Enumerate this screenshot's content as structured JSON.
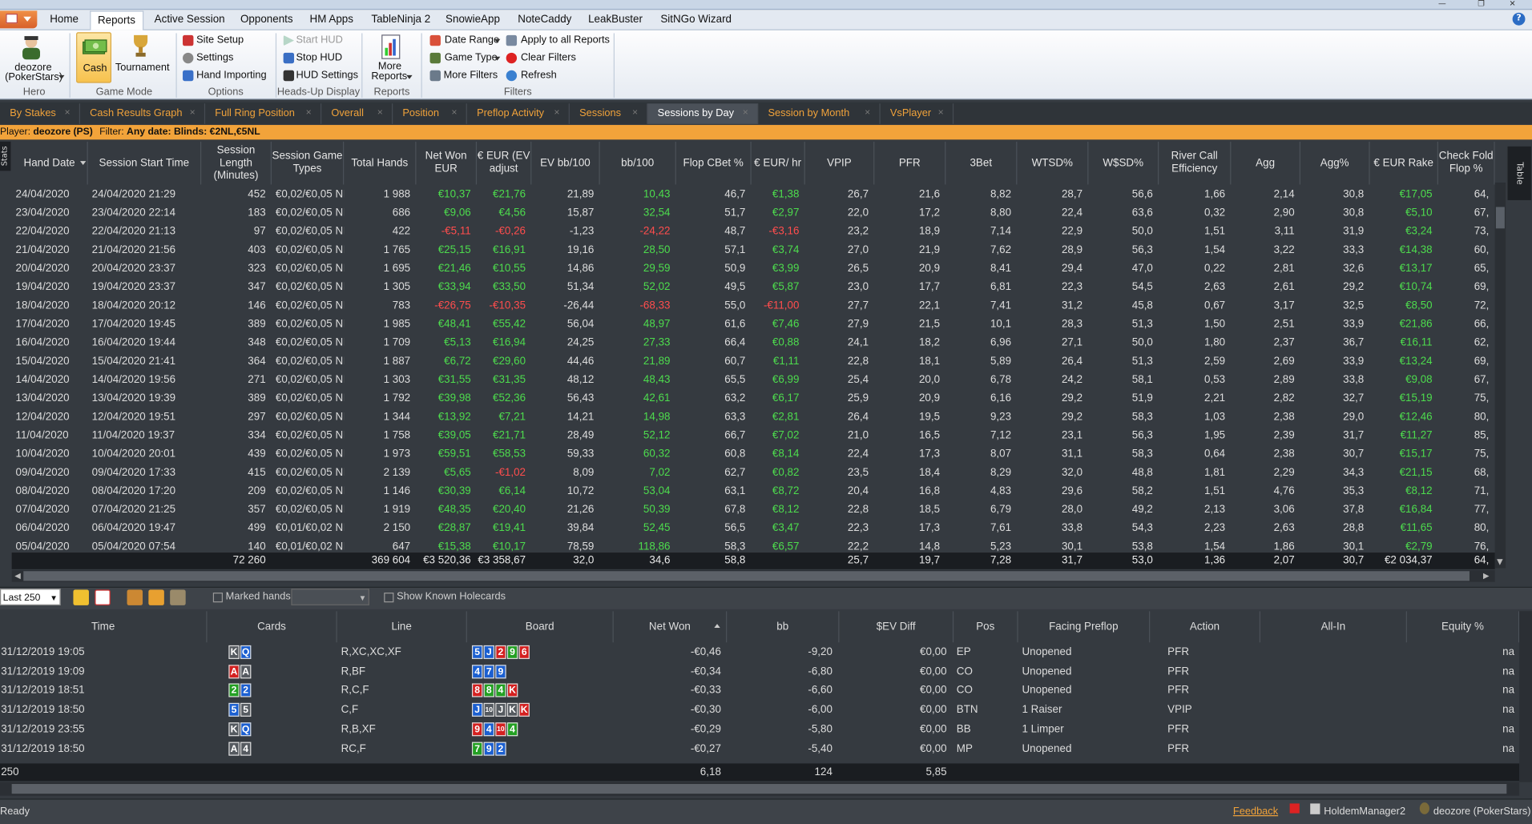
{
  "menu": {
    "tabs": [
      "Home",
      "Reports",
      "Active Session",
      "Opponents",
      "HM Apps",
      "TableNinja 2",
      "SnowieApp",
      "NoteCaddy",
      "LeakBuster",
      "SitNGo Wizard"
    ],
    "active": "Reports"
  },
  "ribbon": {
    "hero": {
      "name": "deozore",
      "site": "(PokerStars)",
      "group": "Hero"
    },
    "game_mode": {
      "cash": "Cash",
      "tournament": "Tournament",
      "group": "Game Mode"
    },
    "options": {
      "site_setup": "Site Setup",
      "settings": "Settings",
      "hand_importing": "Hand Importing",
      "group": "Options"
    },
    "hud": {
      "start": "Start HUD",
      "stop": "Stop HUD",
      "settings": "HUD Settings",
      "group": "Heads-Up Display"
    },
    "reports": {
      "more1": "More",
      "more2": "Reports",
      "group": "Reports"
    },
    "filters": {
      "date_range": "Date Range",
      "game_type": "Game Type",
      "more_filters": "More Filters",
      "apply_all": "Apply to all Reports",
      "clear": "Clear Filters",
      "refresh": "Refresh",
      "group": "Filters"
    }
  },
  "report_tabs": [
    "By Stakes",
    "Cash Results Graph",
    "Full Ring Position",
    "Overall",
    "Position",
    "Preflop Activity",
    "Sessions",
    "Sessions by Day",
    "Session by Month",
    "VsPlayer"
  ],
  "active_report_tab": "Sessions by Day",
  "filter_bar": {
    "player_label": "Player:",
    "player": "deozore (PS)",
    "filter_label": "Filter:",
    "filter": "Any date: Blinds: €2NL,€5NL"
  },
  "side_tab": "Stats",
  "table_side_tab": "Table",
  "grid": {
    "columns": [
      "Hand Date",
      "Session Start Time",
      "Session Length (Minutes)",
      "Session Game Types",
      "Total Hands",
      "Net Won EUR",
      "€ EUR (EV adjust",
      "EV bb/100",
      "bb/100",
      "Flop CBet %",
      "€ EUR/ hr",
      "VPIP",
      "PFR",
      "3Bet",
      "WTSD%",
      "W$SD%",
      "River Call Efficiency",
      "Agg",
      "Agg%",
      "€ EUR Rake",
      "Check Fold Flop %"
    ],
    "rows": [
      [
        "24/04/2020",
        "24/04/2020 21:29",
        "452",
        "€0,02/€0,05 NI",
        "1 988",
        "€10,37",
        "€21,76",
        "21,89",
        "10,43",
        "46,7",
        "€1,38",
        "26,7",
        "21,6",
        "8,82",
        "28,7",
        "56,6",
        "1,66",
        "2,14",
        "30,8",
        "€17,05",
        "64,"
      ],
      [
        "23/04/2020",
        "23/04/2020 22:14",
        "183",
        "€0,02/€0,05 NI",
        "686",
        "€9,06",
        "€4,56",
        "15,87",
        "32,54",
        "51,7",
        "€2,97",
        "22,0",
        "17,2",
        "8,80",
        "22,4",
        "63,6",
        "0,32",
        "2,90",
        "30,8",
        "€5,10",
        "67,"
      ],
      [
        "22/04/2020",
        "22/04/2020 21:13",
        "97",
        "€0,02/€0,05 NI",
        "422",
        "-€5,11",
        "-€0,26",
        "-1,23",
        "-24,22",
        "48,7",
        "-€3,16",
        "23,2",
        "18,9",
        "7,14",
        "22,9",
        "50,0",
        "1,51",
        "3,11",
        "31,9",
        "€3,24",
        "73,"
      ],
      [
        "21/04/2020",
        "21/04/2020 21:56",
        "403",
        "€0,02/€0,05 NI",
        "1 765",
        "€25,15",
        "€16,91",
        "19,16",
        "28,50",
        "57,1",
        "€3,74",
        "27,0",
        "21,9",
        "7,62",
        "28,9",
        "56,3",
        "1,54",
        "3,22",
        "33,3",
        "€14,38",
        "60,"
      ],
      [
        "20/04/2020",
        "20/04/2020 23:37",
        "323",
        "€0,02/€0,05 NI",
        "1 695",
        "€21,46",
        "€10,55",
        "14,86",
        "29,59",
        "50,9",
        "€3,99",
        "26,5",
        "20,9",
        "8,41",
        "29,4",
        "47,0",
        "0,22",
        "2,81",
        "32,6",
        "€13,17",
        "65,"
      ],
      [
        "19/04/2020",
        "19/04/2020 23:37",
        "347",
        "€0,02/€0,05 NI",
        "1 305",
        "€33,94",
        "€33,50",
        "51,34",
        "52,02",
        "49,5",
        "€5,87",
        "23,0",
        "17,7",
        "6,81",
        "22,3",
        "54,5",
        "2,63",
        "2,61",
        "29,2",
        "€10,74",
        "69,"
      ],
      [
        "18/04/2020",
        "18/04/2020 20:12",
        "146",
        "€0,02/€0,05 NI",
        "783",
        "-€26,75",
        "-€10,35",
        "-26,44",
        "-68,33",
        "55,0",
        "-€11,00",
        "27,7",
        "22,1",
        "7,41",
        "31,2",
        "45,8",
        "0,67",
        "3,17",
        "32,5",
        "€8,50",
        "72,"
      ],
      [
        "17/04/2020",
        "17/04/2020 19:45",
        "389",
        "€0,02/€0,05 NI",
        "1 985",
        "€48,41",
        "€55,42",
        "56,04",
        "48,97",
        "61,6",
        "€7,46",
        "27,9",
        "21,5",
        "10,1",
        "28,3",
        "51,3",
        "1,50",
        "2,51",
        "33,9",
        "€21,86",
        "66,"
      ],
      [
        "16/04/2020",
        "16/04/2020 19:44",
        "348",
        "€0,02/€0,05 NI",
        "1 709",
        "€5,13",
        "€16,94",
        "24,25",
        "27,33",
        "66,4",
        "€0,88",
        "24,1",
        "18,2",
        "6,96",
        "27,1",
        "50,0",
        "1,80",
        "2,37",
        "36,7",
        "€16,11",
        "62,"
      ],
      [
        "15/04/2020",
        "15/04/2020 21:41",
        "364",
        "€0,02/€0,05 NI",
        "1 887",
        "€6,72",
        "€29,60",
        "44,46",
        "21,89",
        "60,7",
        "€1,11",
        "22,8",
        "18,1",
        "5,89",
        "26,4",
        "51,3",
        "2,59",
        "2,69",
        "33,9",
        "€13,24",
        "69,"
      ],
      [
        "14/04/2020",
        "14/04/2020 19:56",
        "271",
        "€0,02/€0,05 NI",
        "1 303",
        "€31,55",
        "€31,35",
        "48,12",
        "48,43",
        "65,5",
        "€6,99",
        "25,4",
        "20,0",
        "6,78",
        "24,2",
        "58,1",
        "0,53",
        "2,89",
        "33,8",
        "€9,08",
        "67,"
      ],
      [
        "13/04/2020",
        "13/04/2020 19:39",
        "389",
        "€0,02/€0,05 NI",
        "1 792",
        "€39,98",
        "€52,36",
        "56,43",
        "42,61",
        "63,2",
        "€6,17",
        "25,9",
        "20,9",
        "6,16",
        "29,2",
        "51,9",
        "2,21",
        "2,82",
        "32,7",
        "€15,19",
        "75,"
      ],
      [
        "12/04/2020",
        "12/04/2020 19:51",
        "297",
        "€0,02/€0,05 NI",
        "1 344",
        "€13,92",
        "€7,21",
        "14,21",
        "14,98",
        "63,3",
        "€2,81",
        "26,4",
        "19,5",
        "9,23",
        "29,2",
        "58,3",
        "1,03",
        "2,38",
        "29,0",
        "€12,46",
        "80,"
      ],
      [
        "11/04/2020",
        "11/04/2020 19:37",
        "334",
        "€0,02/€0,05 NI",
        "1 758",
        "€39,05",
        "€21,71",
        "28,49",
        "52,12",
        "66,7",
        "€7,02",
        "21,0",
        "16,5",
        "7,12",
        "23,1",
        "56,3",
        "1,95",
        "2,39",
        "31,7",
        "€11,27",
        "85,"
      ],
      [
        "10/04/2020",
        "10/04/2020 20:01",
        "439",
        "€0,02/€0,05 NI",
        "1 973",
        "€59,51",
        "€58,53",
        "59,33",
        "60,32",
        "60,8",
        "€8,14",
        "22,4",
        "17,3",
        "8,07",
        "31,1",
        "58,3",
        "0,64",
        "2,38",
        "30,7",
        "€15,17",
        "75,"
      ],
      [
        "09/04/2020",
        "09/04/2020 17:33",
        "415",
        "€0,02/€0,05 NI",
        "2 139",
        "€5,65",
        "-€1,02",
        "8,09",
        "7,02",
        "62,7",
        "€0,82",
        "23,5",
        "18,4",
        "8,29",
        "32,0",
        "48,8",
        "1,81",
        "2,29",
        "34,3",
        "€21,15",
        "68,"
      ],
      [
        "08/04/2020",
        "08/04/2020 17:20",
        "209",
        "€0,02/€0,05 NI",
        "1 146",
        "€30,39",
        "€6,14",
        "10,72",
        "53,04",
        "63,1",
        "€8,72",
        "20,4",
        "16,8",
        "4,83",
        "29,6",
        "58,2",
        "1,51",
        "4,76",
        "35,3",
        "€8,12",
        "71,"
      ],
      [
        "07/04/2020",
        "07/04/2020 21:25",
        "357",
        "€0,02/€0,05 NI",
        "1 919",
        "€48,35",
        "€20,40",
        "21,26",
        "50,39",
        "67,8",
        "€8,12",
        "22,8",
        "18,5",
        "6,79",
        "28,0",
        "49,2",
        "2,13",
        "3,06",
        "37,8",
        "€16,84",
        "77,"
      ],
      [
        "06/04/2020",
        "06/04/2020 19:47",
        "499",
        "€0,01/€0,02 NI",
        "2 150",
        "€28,87",
        "€19,41",
        "39,84",
        "52,45",
        "56,5",
        "€3,47",
        "22,3",
        "17,3",
        "7,61",
        "33,8",
        "54,3",
        "2,23",
        "2,63",
        "28,8",
        "€11,65",
        "80,"
      ],
      [
        "05/04/2020",
        "05/04/2020 07:54",
        "140",
        "€0,01/€0,02 NI",
        "647",
        "€15,38",
        "€10,17",
        "78,59",
        "118,86",
        "58,3",
        "€6,57",
        "22,2",
        "14,8",
        "5,23",
        "30,1",
        "53,8",
        "1,54",
        "1,86",
        "30,1",
        "€2,79",
        "76,"
      ]
    ],
    "totals": [
      "",
      "",
      "72 260",
      "",
      "369 604",
      "€3 520,36",
      "€3 358,67",
      "32,0",
      "34,6",
      "58,8",
      "",
      "25,7",
      "19,7",
      "7,28",
      "31,7",
      "53,0",
      "1,36",
      "2,07",
      "30,7",
      "€2 034,37",
      "64,"
    ]
  },
  "hands_toolbar": {
    "range": "Last 250",
    "marked_hands": "Marked hands",
    "show_known": "Show Known Holecards"
  },
  "hands": {
    "columns": [
      "Time",
      "Cards",
      "Line",
      "Board",
      "Net Won",
      "bb",
      "$EV Diff",
      "Pos",
      "Facing Preflop",
      "Action",
      "All-In",
      "Equity %"
    ],
    "rows": [
      {
        "time": "31/12/2019 19:05",
        "cards": [
          [
            "K",
            "s"
          ],
          [
            "Q",
            "d"
          ]
        ],
        "line": "R,XC,XC,XF",
        "board": [
          [
            "5",
            "d"
          ],
          [
            "J",
            "d"
          ],
          [
            "2",
            "h"
          ],
          [
            "9",
            "c"
          ],
          [
            "6",
            "h"
          ]
        ],
        "net": "-€0,46",
        "bb": "-9,20",
        "ev": "€0,00",
        "pos": "EP",
        "facing": "Unopened",
        "action": "PFR",
        "allin": "",
        "equity": "na"
      },
      {
        "time": "31/12/2019 19:09",
        "cards": [
          [
            "A",
            "h"
          ],
          [
            "A",
            "s"
          ]
        ],
        "line": "R,BF",
        "board": [
          [
            "4",
            "d"
          ],
          [
            "7",
            "d"
          ],
          [
            "9",
            "d"
          ]
        ],
        "net": "-€0,34",
        "bb": "-6,80",
        "ev": "€0,00",
        "pos": "CO",
        "facing": "Unopened",
        "action": "PFR",
        "allin": "",
        "equity": "na"
      },
      {
        "time": "31/12/2019 18:51",
        "cards": [
          [
            "2",
            "c"
          ],
          [
            "2",
            "d"
          ]
        ],
        "line": "R,C,F",
        "board": [
          [
            "8",
            "h"
          ],
          [
            "8",
            "c"
          ],
          [
            "4",
            "c"
          ],
          [
            "K",
            "h"
          ]
        ],
        "net": "-€0,33",
        "bb": "-6,60",
        "ev": "€0,00",
        "pos": "CO",
        "facing": "Unopened",
        "action": "PFR",
        "allin": "",
        "equity": "na"
      },
      {
        "time": "31/12/2019 18:50",
        "cards": [
          [
            "5",
            "d"
          ],
          [
            "5",
            "s"
          ]
        ],
        "line": "C,F",
        "board": [
          [
            "J",
            "d"
          ],
          [
            "10",
            "s"
          ],
          [
            "J",
            "s"
          ],
          [
            "K",
            "s"
          ],
          [
            "K",
            "h"
          ]
        ],
        "net": "-€0,30",
        "bb": "-6,00",
        "ev": "€0,00",
        "pos": "BTN",
        "facing": "1 Raiser",
        "action": "VPIP",
        "allin": "",
        "equity": "na"
      },
      {
        "time": "31/12/2019 23:55",
        "cards": [
          [
            "K",
            "s"
          ],
          [
            "Q",
            "d"
          ]
        ],
        "line": "R,B,XF",
        "board": [
          [
            "9",
            "h"
          ],
          [
            "4",
            "d"
          ],
          [
            "10",
            "h"
          ],
          [
            "4",
            "c"
          ]
        ],
        "net": "-€0,29",
        "bb": "-5,80",
        "ev": "€0,00",
        "pos": "BB",
        "facing": "1 Limper",
        "action": "PFR",
        "allin": "",
        "equity": "na"
      },
      {
        "time": "31/12/2019 18:50",
        "cards": [
          [
            "A",
            "s"
          ],
          [
            "4",
            "s"
          ]
        ],
        "line": "RC,F",
        "board": [
          [
            "7",
            "c"
          ],
          [
            "9",
            "d"
          ],
          [
            "2",
            "d"
          ]
        ],
        "net": "-€0,27",
        "bb": "-5,40",
        "ev": "€0,00",
        "pos": "MP",
        "facing": "Unopened",
        "action": "PFR",
        "allin": "",
        "equity": "na"
      }
    ],
    "totals": {
      "count": "250",
      "net": "6,18",
      "bb": "124",
      "ev": "5,85"
    }
  },
  "status": {
    "ready": "Ready",
    "feedback": "Feedback",
    "app": "HoldemManager2",
    "player": "deozore (PokerStars)"
  },
  "colors": {
    "positive": "#4ddc4d",
    "negative": "#ff4d4d",
    "accent": "#f0a23a"
  }
}
